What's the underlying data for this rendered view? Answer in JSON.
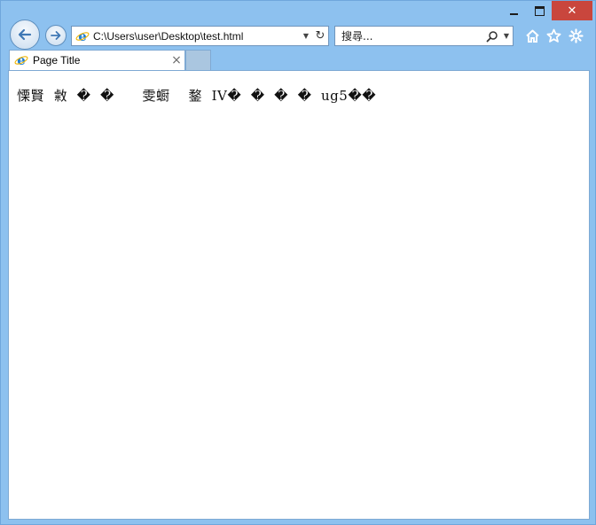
{
  "window": {
    "controls": {
      "minimize_icon": "minimize-icon",
      "maximize_icon": "maximize-icon",
      "close_label": "✕"
    }
  },
  "nav": {
    "back_icon": "back-arrow-icon",
    "forward_icon": "forward-arrow-icon",
    "address": "C:\\Users\\user\\Desktop\\test.html",
    "search_placeholder": "搜尋...",
    "search_icon": "magnifier-icon",
    "toolbar_icons": [
      "home-icon",
      "favorites-star-icon",
      "settings-gear-icon"
    ]
  },
  "tabs": [
    {
      "title": "Page Title",
      "active": true,
      "close_label": "×"
    }
  ],
  "page": {
    "text": "慄賢  敹  �  �      雯蟵    鍪  IV�  �  �  �  ug5��"
  },
  "colors": {
    "frame": "#8dc1ef",
    "close_button": "#c9463d",
    "ie_icon": "#1f7fd3",
    "tab_inactive": "#aac6e0"
  }
}
